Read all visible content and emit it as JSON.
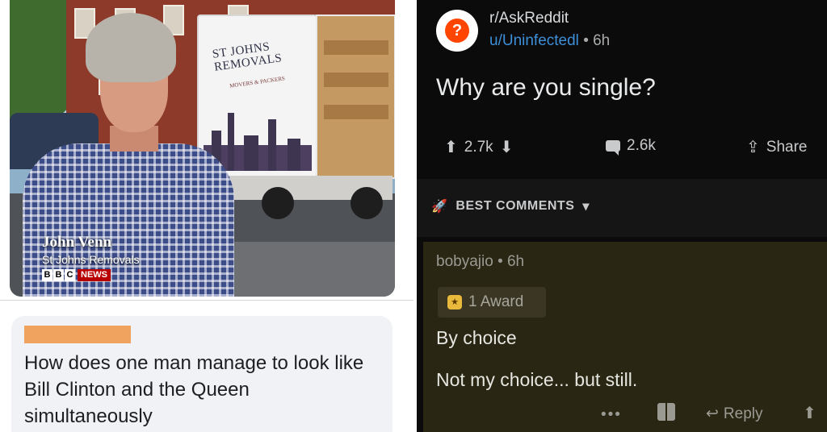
{
  "left": {
    "news_caption": {
      "name": "John Venn",
      "organization": "St Johns Removals",
      "broadcaster_blocks": [
        "B",
        "B",
        "C"
      ],
      "broadcaster_label": "NEWS"
    },
    "truck_logo": {
      "title": "ST JOHNS REMOVALS",
      "subtitle": "MOVERS & PACKERS"
    },
    "comment_text": "How does one man manage to look like Bill Clinton and the Queen simultaneously"
  },
  "right": {
    "subreddit": "r/AskReddit",
    "username": "u/Uninfectedl",
    "post_age": "• 6h",
    "post_title": "Why are you single?",
    "votes": "2.7k",
    "comments_count": "2.6k",
    "share_label": "Share",
    "sort_label": "BEST COMMENTS",
    "top_comment": {
      "author": "bobyajio",
      "age": "• 6h",
      "award_label": "1 Award",
      "line1": "By choice",
      "line2": "Not my choice... but still.",
      "more_label": "•••",
      "reply_label": "Reply"
    }
  },
  "colors": {
    "reddit_background": "#0b0b0b",
    "comment_highlight": "#2a2614",
    "username_blue": "#3d8fd8",
    "bbc_red": "#b80000",
    "redaction_orange": "#f0a35e"
  }
}
